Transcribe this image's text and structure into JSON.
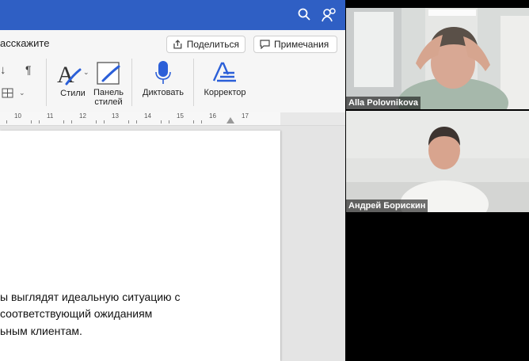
{
  "word": {
    "tell_me": "асскажите",
    "share_label": "Поделиться",
    "comments_label": "Примечания",
    "tools": {
      "styles": "Стили",
      "styles_pane_1": "Панель",
      "styles_pane_2": "стилей",
      "dictate": "Диктовать",
      "editor": "Корректор"
    },
    "ruler_numbers": [
      "10",
      "11",
      "12",
      "13",
      "14",
      "15",
      "16",
      "17"
    ],
    "document_lines": [
      "ы выглядят идеальную ситуацию с",
      "соответствующий ожиданиям",
      "ьным клиентам."
    ]
  },
  "participants": [
    {
      "name": "Alla Polovnikova"
    },
    {
      "name": "Андрей Борискин"
    }
  ],
  "colors": {
    "titlebar": "#2f5fc4",
    "accent": "#2b5fd8"
  }
}
